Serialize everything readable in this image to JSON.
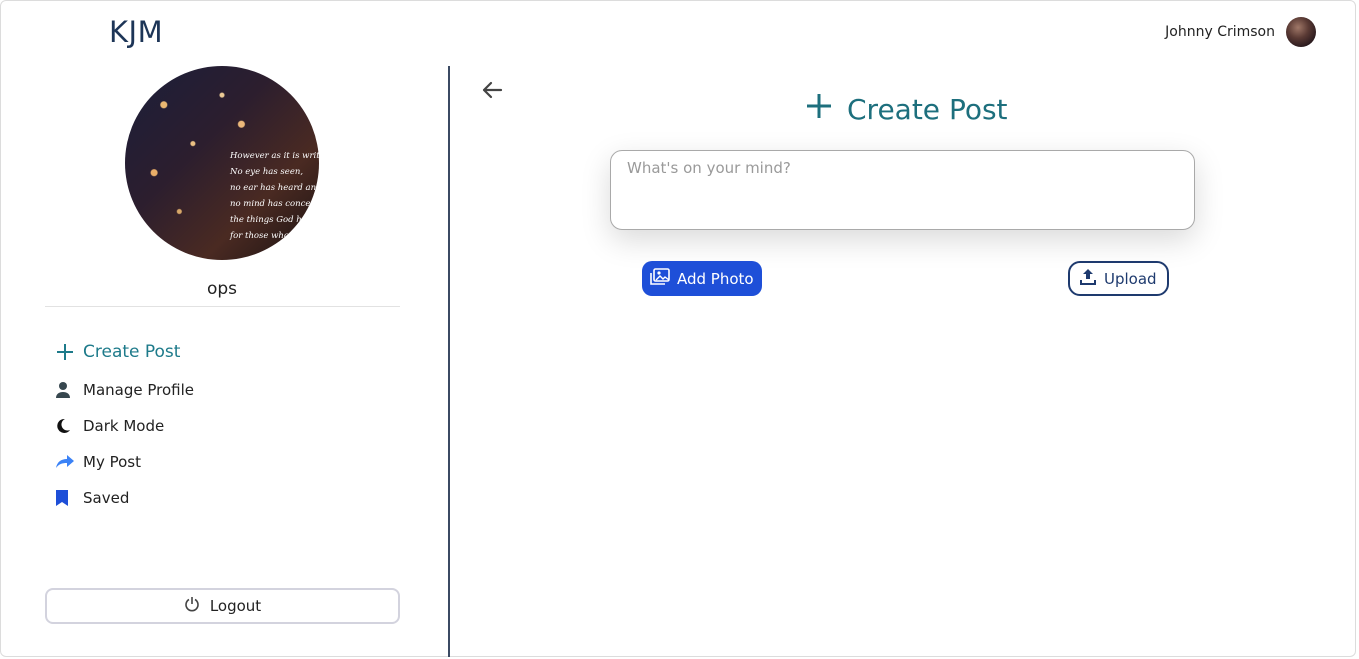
{
  "header": {
    "brand": "KJM",
    "user_name": "Johnny Crimson"
  },
  "sidebar": {
    "profile_quote_lines": [
      "However as it is written",
      "No eye has seen,",
      "no ear has heard and",
      "no mind has conceived",
      "the things God has pre",
      "for those who lo"
    ],
    "profile_name": "ops",
    "items": [
      {
        "label": "Create Post",
        "icon": "plus-icon",
        "active": true,
        "color": "#1d7a8a"
      },
      {
        "label": "Manage Profile",
        "icon": "user-icon",
        "active": false,
        "color": "#37474f"
      },
      {
        "label": "Dark Mode",
        "icon": "moon-icon",
        "active": false,
        "color": "#111111"
      },
      {
        "label": "My Post",
        "icon": "share-icon",
        "active": false,
        "color": "#3b82f6"
      },
      {
        "label": "Saved",
        "icon": "bookmark-icon",
        "active": false,
        "color": "#1e4fd8"
      }
    ],
    "logout_label": "Logout"
  },
  "main": {
    "title": "Create Post",
    "post_placeholder": "What's on your mind?",
    "post_value": "",
    "add_photo_label": "Add Photo",
    "upload_label": "Upload"
  },
  "colors": {
    "accent_teal": "#1d6f7d",
    "primary_blue": "#1e4fd8",
    "navy": "#1e3a6e"
  }
}
